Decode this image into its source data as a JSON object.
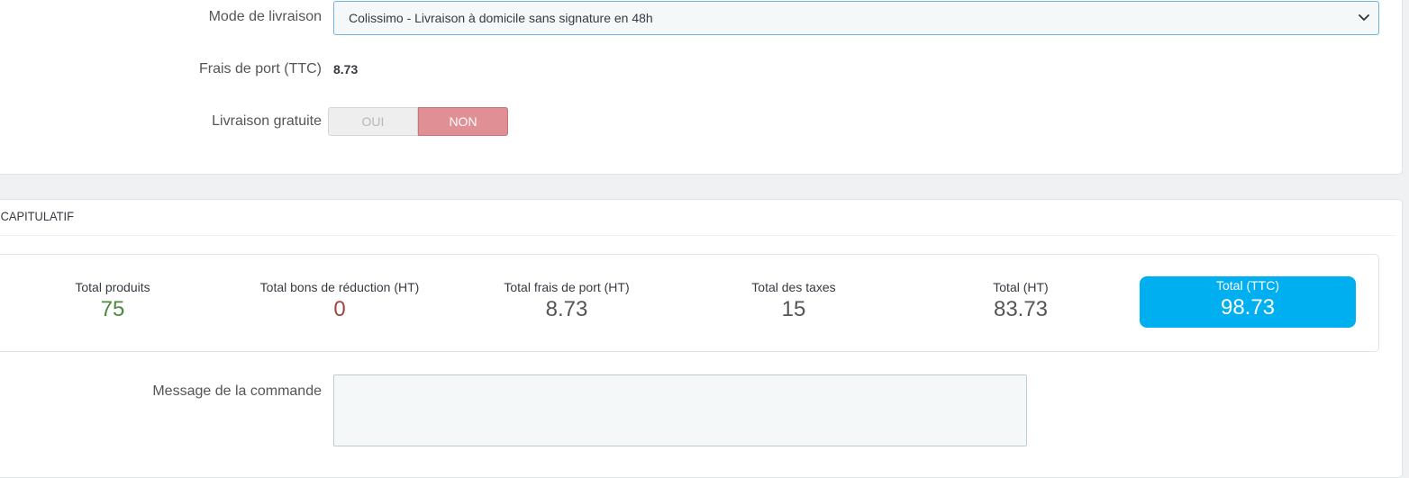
{
  "delivery": {
    "mode_label": "Mode de livraison",
    "mode_selected": "Colissimo - Livraison à domicile sans signature en 48h",
    "shipping_fee_label": "Frais de port (TTC)",
    "shipping_fee_value": "8.73",
    "free_shipping_label": "Livraison gratuite",
    "free_shipping_yes": "OUI",
    "free_shipping_no": "NON"
  },
  "summary": {
    "title": "ÉCAPITULATIF",
    "totals": [
      {
        "label": "Total produits",
        "value": "75",
        "color": "#4c8a3f"
      },
      {
        "label": "Total bons de réduction (HT)",
        "value": "0",
        "color": "#a0463f"
      },
      {
        "label": "Total frais de port (HT)",
        "value": "8.73",
        "color": "#555555"
      },
      {
        "label": "Total des taxes",
        "value": "15",
        "color": "#555555"
      },
      {
        "label": "Total (HT)",
        "value": "83.73",
        "color": "#555555"
      },
      {
        "label": "Total (TTC)",
        "value": "98.73",
        "color": "#ffffff"
      }
    ]
  },
  "order_message": {
    "label": "Message de la commande",
    "value": ""
  },
  "colors": {
    "accent": "#00aff0",
    "switch_off": "#e08f95",
    "panel_bg": "#ffffff",
    "page_bg": "#eff1f2"
  }
}
